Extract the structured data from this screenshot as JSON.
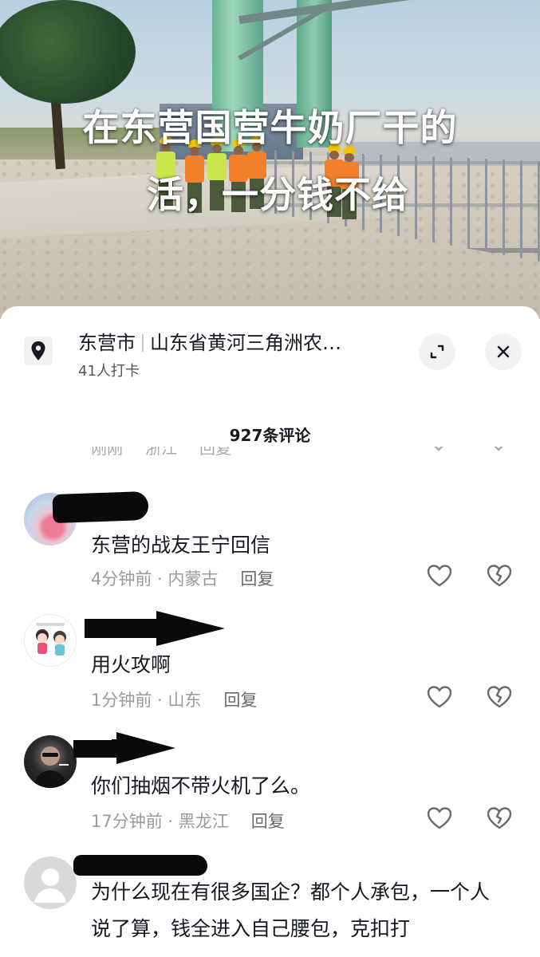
{
  "video": {
    "caption_line1": "在东营国营牛奶厂干的",
    "caption_line2": "活，一分钱不给"
  },
  "location": {
    "city": "东营市",
    "place": "山东省黄河三角洲农…",
    "checkins": "41人打卡"
  },
  "comments_header": {
    "count_label": "927条评论"
  },
  "previous_row": {
    "time": "刚刚",
    "region": "浙江",
    "reply": "回复"
  },
  "comments": [
    {
      "text": "东营的战友王宁回信",
      "time": "4分钟前",
      "region": "内蒙古",
      "reply": "回复"
    },
    {
      "text": "用火攻啊",
      "time": "1分钟前",
      "region": "山东",
      "reply": "回复"
    },
    {
      "text": "你们抽烟不带火机了么。",
      "time": "17分钟前",
      "region": "黑龙江",
      "reply": "回复"
    },
    {
      "text": "为什么现在有很多国企？都个人承包，一个人说了算，钱全进入自己腰包，克扣打"
    }
  ],
  "icons": {
    "location": "location-pin-icon",
    "expand": "expand-icon",
    "close": "close-icon",
    "like": "heart-icon",
    "dislike": "broken-heart-icon"
  },
  "colors": {
    "text": "#161823",
    "meta": "#9a9a9a",
    "redaction": "#0a0a0a"
  }
}
